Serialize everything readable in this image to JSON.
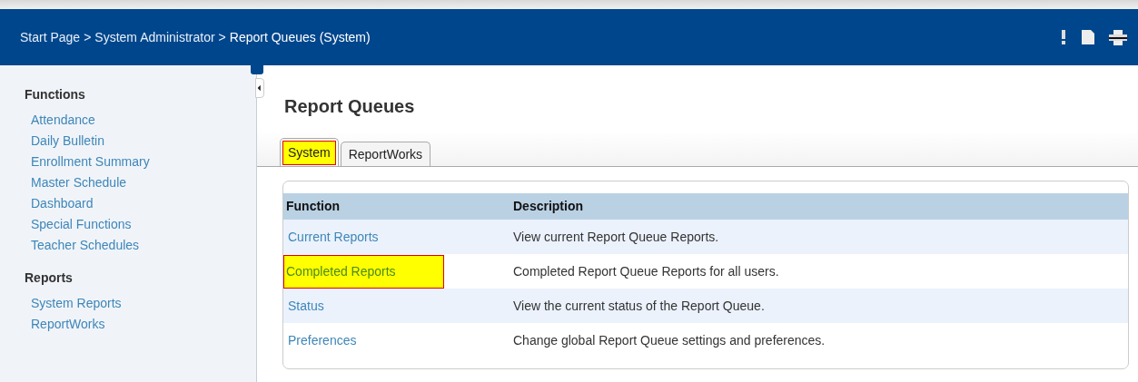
{
  "breadcrumb": {
    "separator": ">",
    "items": [
      "Start Page",
      "System Administrator",
      "Report Queues (System)"
    ]
  },
  "sidebar": {
    "sections": [
      {
        "title": "Functions",
        "items": [
          "Attendance",
          "Daily Bulletin",
          "Enrollment Summary",
          "Master Schedule",
          "Dashboard",
          "Special Functions",
          "Teacher Schedules"
        ]
      },
      {
        "title": "Reports",
        "items": [
          "System Reports",
          "ReportWorks"
        ]
      }
    ]
  },
  "page_title": "Report Queues",
  "tabs": [
    {
      "label": "System",
      "selected": true,
      "highlighted": true
    },
    {
      "label": "ReportWorks",
      "selected": false,
      "highlighted": false
    }
  ],
  "table": {
    "columns": [
      "Function",
      "Description"
    ],
    "rows": [
      {
        "function": "Current Reports",
        "description": "View current Report Queue Reports.",
        "highlighted": false
      },
      {
        "function": "Completed Reports",
        "description": "Completed Report Queue Reports for all users.",
        "highlighted": true
      },
      {
        "function": "Status",
        "description": "View the current status of the Report Queue.",
        "highlighted": false
      },
      {
        "function": "Preferences",
        "description": "Change global Report Queue settings and preferences.",
        "highlighted": false
      }
    ]
  }
}
